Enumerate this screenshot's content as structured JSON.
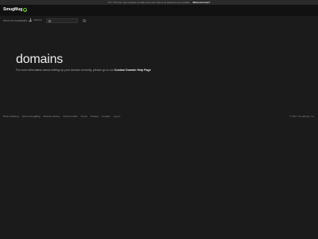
{
  "notice": {
    "text": "FYI: This site uses cookies to make sure your visit is as awesome as possible.",
    "link": "What and why?"
  },
  "header": {
    "logo_text": "SmugMug"
  },
  "nav": {
    "label": "PHOTOS &AMPERS",
    "login_label": "LOG IN",
    "search_placeholder": ""
  },
  "main": {
    "heading": "domains",
    "info_text": "For more information about setting up your domain correctly, please go to our",
    "info_link": "Custom Domain Help Page"
  },
  "footer": {
    "links": [
      "Photo Sharing",
      "About SmugMug",
      "Browse Photos",
      "Prints & Gifts",
      "Terms",
      "Privacy",
      "Contact",
      "Log In"
    ],
    "copyright": "© 2017 SmugMug, Inc."
  },
  "colors": {
    "background": "#1b1b1b",
    "topbar": "#111111",
    "accent": "#6bcf2c"
  }
}
